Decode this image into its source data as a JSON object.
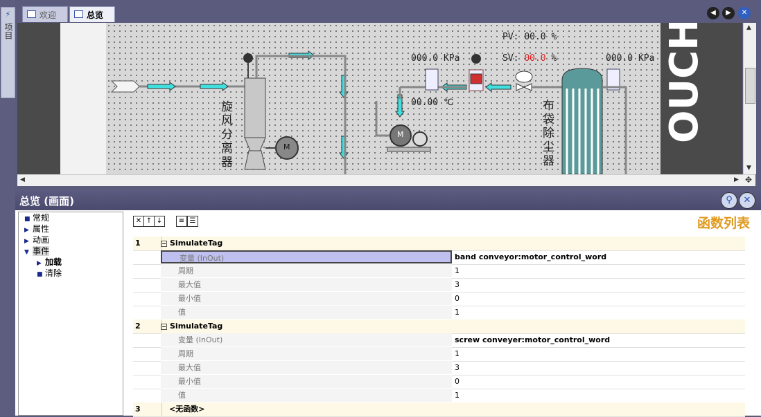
{
  "sidebar": {
    "tab_label": "项目"
  },
  "tabs": [
    {
      "label": "欢迎"
    },
    {
      "label": "总览"
    }
  ],
  "hmi": {
    "pv_label": "PV:",
    "pv_value": "00.0",
    "pv_unit": "%",
    "sv_label": "SV:",
    "sv_value": "00.0",
    "sv_unit": "%",
    "pressure_left": "000.0 KPa",
    "pressure_right": "000.0 KPa",
    "temperature": "00.00 ℃",
    "cyclone_label": "旋风分离器",
    "dust_label": "布袋除尘器",
    "motor_label": "M",
    "touch_text": "OUCH",
    "colors": {
      "pipe": "#888888",
      "arrow": "#40e0e0",
      "sv": "#e02020"
    }
  },
  "props": {
    "title": "总览 (画面)",
    "function_list_title": "函数列表",
    "tree": [
      {
        "label": "常规",
        "marker": "square"
      },
      {
        "label": "属性",
        "marker": "arrow"
      },
      {
        "label": "动画",
        "marker": "arrow"
      },
      {
        "label": "事件",
        "marker": "down"
      },
      {
        "label": "加载",
        "marker": "arrow"
      },
      {
        "label": "清除",
        "marker": "square"
      }
    ],
    "rows": [
      {
        "num": "1",
        "section": "SimulateTag"
      },
      {
        "name": "变量 (InOut)",
        "value": "band conveyor:motor_control_word"
      },
      {
        "name": "周期",
        "value": "1"
      },
      {
        "name": "最大值",
        "value": "3"
      },
      {
        "name": "最小值",
        "value": "0"
      },
      {
        "name": "值",
        "value": "1"
      },
      {
        "num": "2",
        "section": "SimulateTag"
      },
      {
        "name": "变量 (InOut)",
        "value": "screw conveyer:motor_control_word"
      },
      {
        "name": "周期",
        "value": "1"
      },
      {
        "name": "最大值",
        "value": "3"
      },
      {
        "name": "最小值",
        "value": "0"
      },
      {
        "name": "值",
        "value": "1"
      },
      {
        "num": "3",
        "section": "<无函数>"
      }
    ]
  }
}
